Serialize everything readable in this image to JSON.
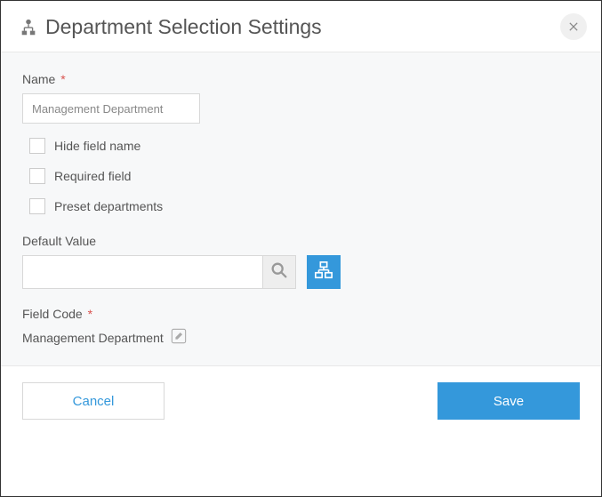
{
  "header": {
    "title": "Department Selection Settings"
  },
  "form": {
    "name_label": "Name",
    "name_value": "Management Department",
    "hide_field_label": "Hide field name",
    "required_label": "Required field",
    "preset_label": "Preset departments",
    "default_value_label": "Default Value",
    "default_value": "",
    "field_code_label": "Field Code",
    "field_code_value": "Management Department"
  },
  "footer": {
    "cancel": "Cancel",
    "save": "Save"
  }
}
